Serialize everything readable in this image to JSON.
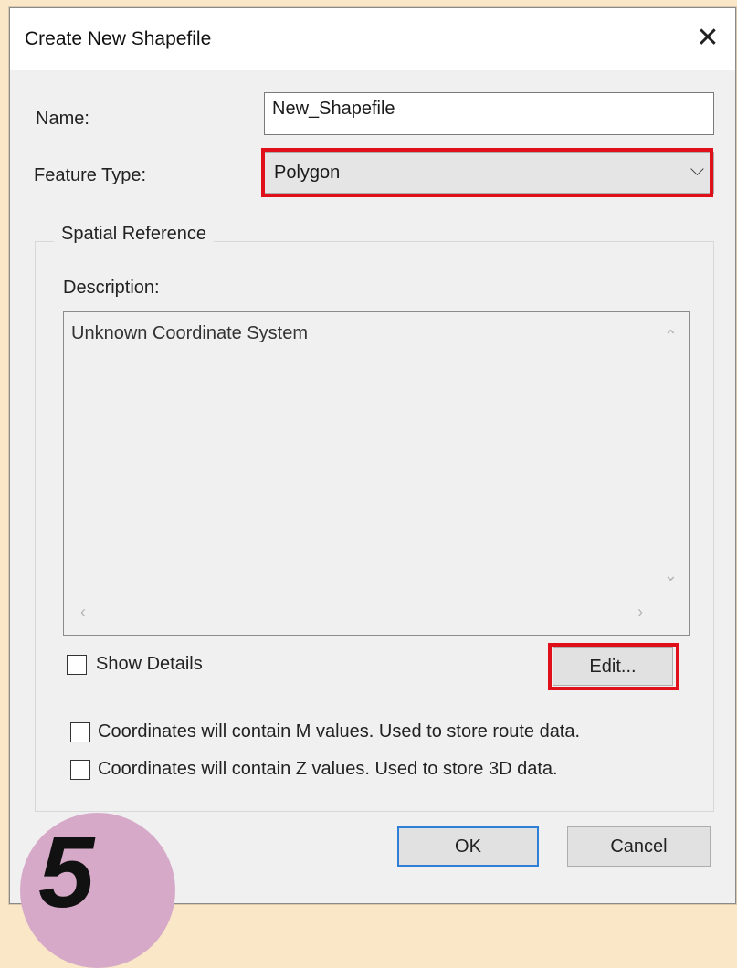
{
  "dialog": {
    "title": "Create New Shapefile",
    "close_glyph": "✕"
  },
  "form": {
    "name_label": "Name:",
    "name_value": "New_Shapefile",
    "feature_type_label": "Feature Type:",
    "feature_type_value": "Polygon"
  },
  "spatial_reference": {
    "group_label": "Spatial Reference",
    "description_label": "Description:",
    "description_value": "Unknown Coordinate System",
    "show_details_label": "Show Details",
    "edit_button": "Edit..."
  },
  "options": {
    "m_values_label": "Coordinates will contain M values. Used to store route data.",
    "z_values_label": "Coordinates will contain Z values. Used to store 3D data."
  },
  "buttons": {
    "ok": "OK",
    "cancel": "Cancel"
  },
  "step_badge": {
    "number": "5"
  },
  "colors": {
    "highlight": "#e0101b",
    "background": "#f9e7c8",
    "step_circle": "#d7a9c8"
  }
}
